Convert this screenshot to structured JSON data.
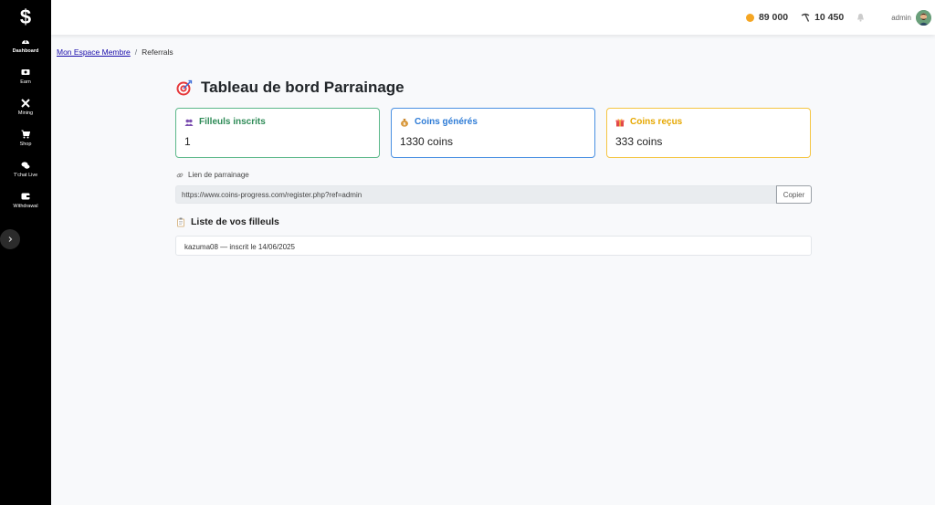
{
  "sidebar": {
    "logo": "$",
    "items": [
      {
        "label": "Dashboard",
        "icon": "dashboard-icon"
      },
      {
        "label": "Earn",
        "icon": "money-icon"
      },
      {
        "label": "Mining",
        "icon": "tools-icon"
      },
      {
        "label": "Shop",
        "icon": "cart-icon"
      },
      {
        "label": "T'chat Live",
        "icon": "chat-icon"
      },
      {
        "label": "Withdrawal",
        "icon": "wallet-icon"
      }
    ],
    "expand_icon": "chevron-right-icon"
  },
  "topbar": {
    "coins": "89 000",
    "mining_power": "10 450",
    "username": "admin",
    "icons": [
      "coin-icon",
      "pickaxe-icon",
      "bell-icon",
      "avatar"
    ]
  },
  "breadcrumb": {
    "parent": "Mon Espace Membre",
    "separator": "/",
    "current": "Referrals"
  },
  "main": {
    "title": "Tableau de bord Parrainage",
    "title_icon": "target-icon",
    "cards": [
      {
        "title": "Filleuls inscrits",
        "value": "1",
        "icon": "users-icon",
        "color": "#2e8b57"
      },
      {
        "title": "Coins générés",
        "value": "1330 coins",
        "icon": "money-bag-icon",
        "color": "#2d7bd6"
      },
      {
        "title": "Coins reçus",
        "value": "333 coins",
        "icon": "gift-icon",
        "color": "#e6a700"
      }
    ],
    "link_label": "Lien de parrainage",
    "link_value": "https://www.coins-progress.com/register.php?ref=admin",
    "copy_label": "Copier",
    "list_title": "Liste de vos filleuls",
    "referrals": [
      {
        "text": "kazuma08 — inscrit le 14/06/2025"
      }
    ]
  },
  "colors": {
    "sidebar_bg": "#000000",
    "page_bg": "#f8f9fb",
    "coin": "#f5a623"
  }
}
